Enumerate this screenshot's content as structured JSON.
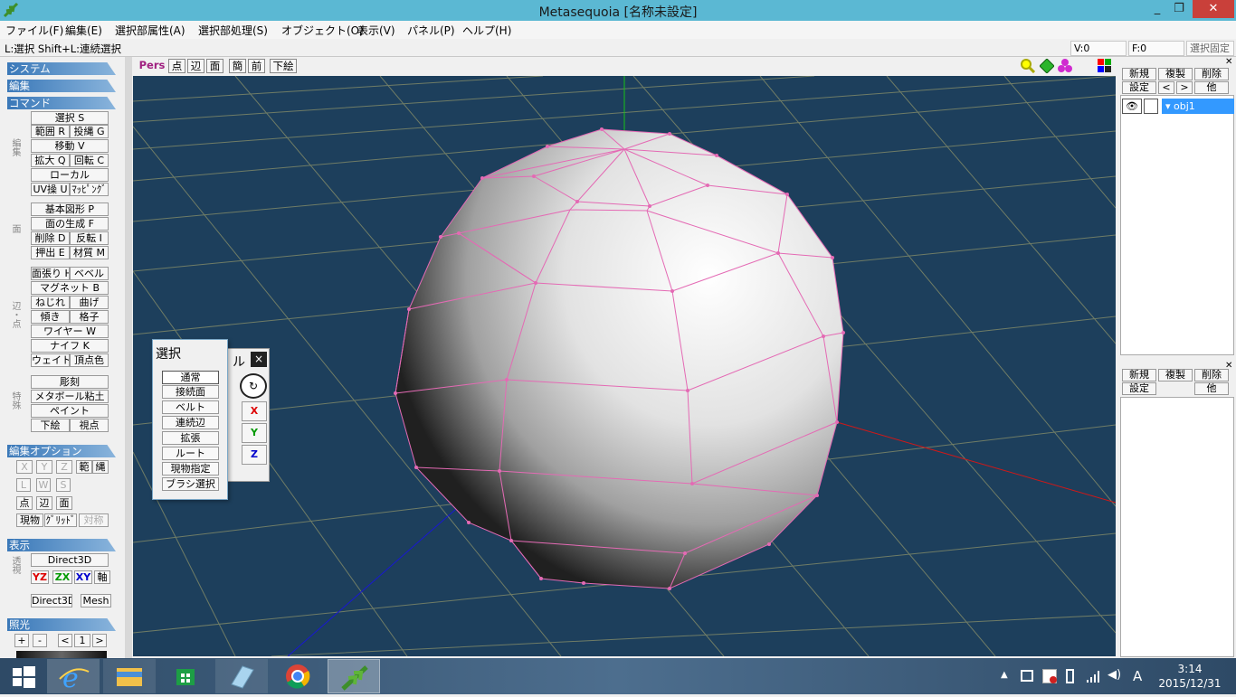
{
  "window": {
    "title": "Metasequoia [名称未設定]",
    "min": "_",
    "max": "❐",
    "close": "✕"
  },
  "menu": [
    "ファイル(F)",
    "編集(E)",
    "選択部属性(A)",
    "選択部処理(S)",
    "オブジェクト(O)",
    "表示(V)",
    "パネル(P)",
    "ヘルプ(H)"
  ],
  "status": {
    "hint": "L:選択  Shift+L:連続選択",
    "v": "V:0",
    "f": "F:0",
    "lock": "選択固定"
  },
  "left": {
    "system": "システム",
    "edit": "編集",
    "command": "コマンド",
    "cmd": [
      "選択 S",
      "範囲 R",
      "投縄 G",
      "移動 V",
      "拡大 Q",
      "回転 C",
      "ローカル",
      "UV操 U",
      "ﾏｯﾋﾟﾝｸﾞ"
    ],
    "cmd_label": "編集",
    "face": [
      "基本図形 P",
      "面の生成 F",
      "削除 D",
      "反転 I",
      "押出 E",
      "材質 M"
    ],
    "face_label": "面",
    "edge": [
      "面張り H",
      "ベベル",
      "マグネット B",
      "ねじれ",
      "曲げ",
      "傾き",
      "格子",
      "ワイヤー W",
      "ナイフ K",
      "ウェイト",
      "頂点色"
    ],
    "edge_label": "辺・点",
    "special": [
      "彫刻",
      "メタボール粘土",
      "ペイント",
      "下絵",
      "視点"
    ],
    "special_label": "特殊",
    "editopt": "編集オプション",
    "opt_axes": [
      "X",
      "Y",
      "Z"
    ],
    "opt_range": "範",
    "opt_lasso": "縄",
    "opt_lws": [
      "L",
      "W",
      "S"
    ],
    "opt_pef": [
      "点",
      "辺",
      "面"
    ],
    "opt_misc": [
      "現物",
      "ｸﾞﾘｯﾄﾞ",
      "対称"
    ],
    "display": "表示",
    "display_label": "透視",
    "direct3d": "Direct3D",
    "yz": "YZ",
    "zx": "ZX",
    "xy": "XY",
    "axis": "軸",
    "d3d2": "Direct3D",
    "mesh": "Mesh",
    "light": "照光",
    "light_btns": [
      "+",
      "-",
      "<",
      "1",
      ">"
    ]
  },
  "viewport": {
    "tabs": [
      "Pers",
      "点",
      "辺",
      "面",
      "簡",
      "前",
      "下絵"
    ],
    "colors": {
      "bg": "#1d3f5c",
      "grid": "#6f7c66",
      "wire": "#e46ab4"
    }
  },
  "popup": {
    "title": "選択",
    "items": [
      "通常",
      "接続面",
      "ベルト",
      "連続辺",
      "拡張",
      "ルート",
      "現物指定",
      "ブラシ選択"
    ],
    "hidden_title": "ル",
    "close": "×",
    "axes": [
      "X",
      "Y",
      "Z"
    ]
  },
  "right": {
    "obj_btns": [
      "新規",
      "複製",
      "削除",
      "設定",
      "<",
      ">",
      "他"
    ],
    "object_name": "obj1",
    "mat_btns": [
      "新規",
      "複製",
      "削除",
      "設定",
      "他"
    ]
  },
  "taskbar": {
    "time": "3:14",
    "date": "2015/12/31",
    "ime": "A"
  }
}
